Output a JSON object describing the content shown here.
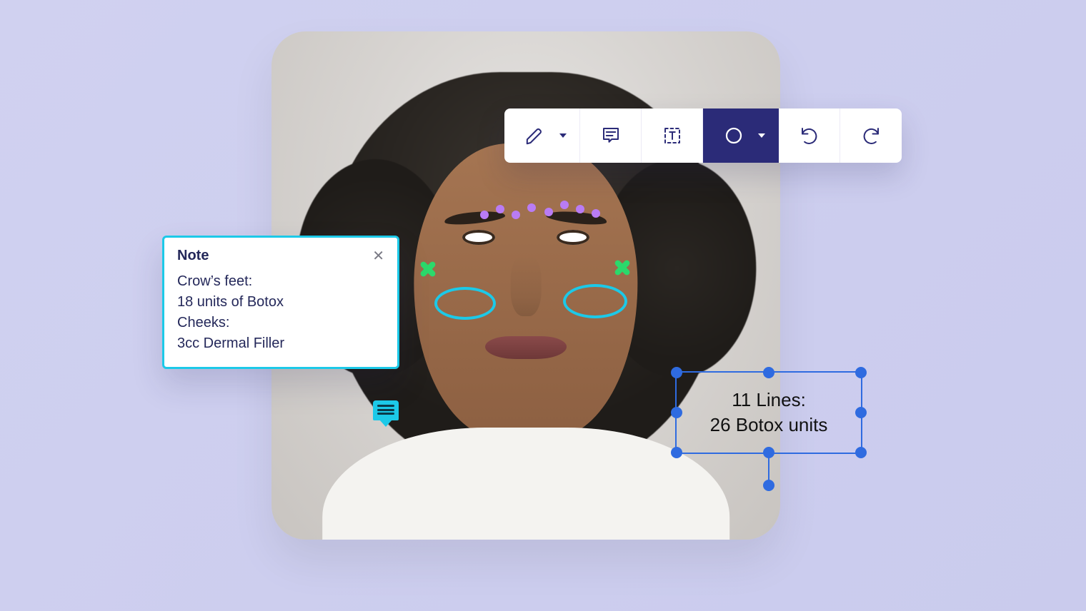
{
  "colors": {
    "accent_navy": "#2b2b78",
    "annotation_cyan": "#1cc9e8",
    "selection_blue": "#2f6be0",
    "marker_green": "#2bd96b",
    "dot_purple": "#b97cf5",
    "background_lavender": "#cdcdee"
  },
  "toolbar": {
    "tools": [
      {
        "name": "pen",
        "has_dropdown": true,
        "active": false
      },
      {
        "name": "comment",
        "has_dropdown": false,
        "active": false
      },
      {
        "name": "text-box",
        "has_dropdown": false,
        "active": false
      },
      {
        "name": "shape-circle",
        "has_dropdown": true,
        "active": true
      },
      {
        "name": "undo",
        "has_dropdown": false,
        "active": false
      },
      {
        "name": "redo",
        "has_dropdown": false,
        "active": false
      }
    ]
  },
  "note": {
    "title": "Note",
    "body": "Crow’s feet:\n18 units of Botox\nCheeks:\n3cc Dermal Filler"
  },
  "textbox": {
    "text": "11 Lines:\n26 Botox units",
    "selected": true
  },
  "annotations": {
    "cheek_ovals": 2,
    "crows_feet_x_marks": 2,
    "glabella_dots": 8
  }
}
